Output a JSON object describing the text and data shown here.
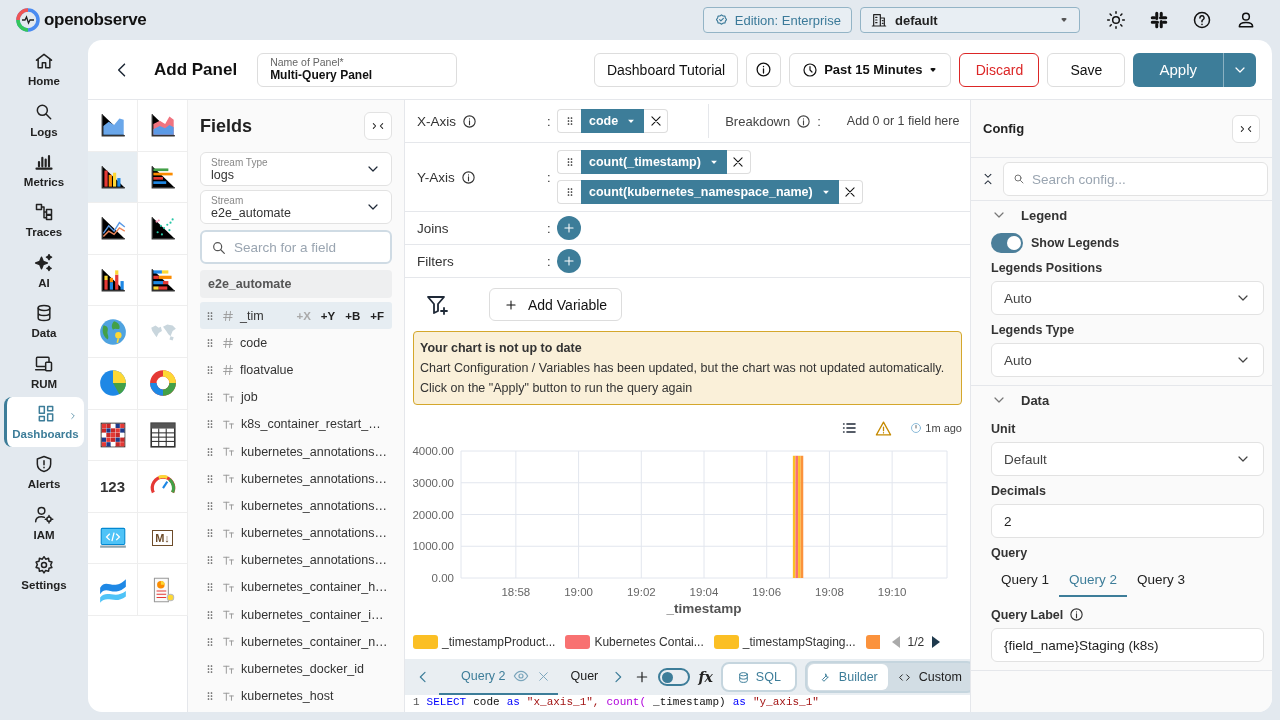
{
  "top_bar": {
    "brand": "openobserve",
    "edition": "Edition: Enterprise",
    "org": "default"
  },
  "nav": [
    {
      "label": "Home",
      "kind": "home",
      "selected": false
    },
    {
      "label": "Logs",
      "kind": "search",
      "selected": false
    },
    {
      "label": "Metrics",
      "kind": "metrics",
      "selected": false
    },
    {
      "label": "Traces",
      "kind": "traces",
      "selected": false
    },
    {
      "label": "AI",
      "kind": "ai",
      "selected": false
    },
    {
      "label": "Data",
      "kind": "data",
      "selected": false
    },
    {
      "label": "RUM",
      "kind": "rum",
      "selected": false
    },
    {
      "label": "Dashboards",
      "kind": "dashboards",
      "selected": true
    },
    {
      "label": "Alerts",
      "kind": "alerts",
      "selected": false
    },
    {
      "label": "IAM",
      "kind": "iam",
      "selected": false
    },
    {
      "label": "Settings",
      "kind": "settings",
      "selected": false
    }
  ],
  "header": {
    "title": "Add Panel",
    "name_label": "Name of Panel*",
    "name_value": "Multi-Query Panel",
    "tutorial": "Dashboard Tutorial",
    "time_range": "Past 15 Minutes",
    "discard": "Discard",
    "save": "Save",
    "apply": "Apply"
  },
  "chart_types": [
    {
      "kind": "area",
      "selected": false
    },
    {
      "kind": "area-stacked",
      "selected": false
    },
    {
      "kind": "bar",
      "selected": true
    },
    {
      "kind": "h-bar",
      "selected": false
    },
    {
      "kind": "line",
      "selected": false
    },
    {
      "kind": "scatter",
      "selected": false
    },
    {
      "kind": "stacked",
      "selected": false
    },
    {
      "kind": "h-stacked",
      "selected": false
    },
    {
      "kind": "geomap",
      "selected": false
    },
    {
      "kind": "maps",
      "selected": false
    },
    {
      "kind": "pie",
      "selected": false
    },
    {
      "kind": "donut",
      "selected": false
    },
    {
      "kind": "heatmap",
      "selected": false
    },
    {
      "kind": "table",
      "selected": false
    },
    {
      "kind": "metric",
      "label": "123",
      "selected": false
    },
    {
      "kind": "gauge",
      "selected": false
    },
    {
      "kind": "html",
      "selected": false
    },
    {
      "kind": "markdown",
      "label": "M↓",
      "selected": false
    },
    {
      "kind": "sankey",
      "selected": false
    },
    {
      "kind": "custom",
      "selected": false
    }
  ],
  "fields_panel": {
    "title": "Fields",
    "stream_type": {
      "label": "Stream Type",
      "value": "logs"
    },
    "stream": {
      "label": "Stream",
      "value": "e2e_automate"
    },
    "search": {
      "placeholder": "Search for a field"
    },
    "stream_name": "e2e_automate",
    "fields": [
      {
        "name": "_tim",
        "kind": "number",
        "hovered": true,
        "actions": [
          {
            "label": "+X",
            "disabled": true
          },
          {
            "label": "+Y",
            "disabled": false
          },
          {
            "label": "+B",
            "disabled": false
          },
          {
            "label": "+F",
            "disabled": false
          }
        ]
      },
      {
        "name": "code",
        "kind": "number",
        "hovered": false
      },
      {
        "name": "floatvalue",
        "kind": "number",
        "hovered": false
      },
      {
        "name": "job",
        "kind": "text",
        "hovered": false
      },
      {
        "name": "k8s_container_restart_…",
        "kind": "text",
        "hovered": false
      },
      {
        "name": "kubernetes_annotations…",
        "kind": "text",
        "hovered": false
      },
      {
        "name": "kubernetes_annotations…",
        "kind": "text",
        "hovered": false
      },
      {
        "name": "kubernetes_annotations…",
        "kind": "text",
        "hovered": false
      },
      {
        "name": "kubernetes_annotations…",
        "kind": "text",
        "hovered": false
      },
      {
        "name": "kubernetes_annotations…",
        "kind": "text",
        "hovered": false
      },
      {
        "name": "kubernetes_container_h…",
        "kind": "text",
        "hovered": false
      },
      {
        "name": "kubernetes_container_i…",
        "kind": "text",
        "hovered": false
      },
      {
        "name": "kubernetes_container_n…",
        "kind": "text",
        "hovered": false
      },
      {
        "name": "kubernetes_docker_id",
        "kind": "text",
        "hovered": false
      },
      {
        "name": "kubernetes_host",
        "kind": "text",
        "hovered": false
      }
    ]
  },
  "builder": [
    {
      "kind": "axis",
      "label": "X-Axis",
      "info": true,
      "separator": ":",
      "chips": [
        "code"
      ],
      "aside": {
        "label": "Breakdown",
        "info": true,
        "separator": ":",
        "placeholder": "Add 0 or 1 field here"
      }
    },
    {
      "kind": "axis",
      "label": "Y-Axis",
      "info": true,
      "separator": ":",
      "chips": [
        "count(_timestamp)",
        "count(kubernetes_namespace_name)"
      ]
    },
    {
      "kind": "add",
      "label": "Joins",
      "separator": ":"
    },
    {
      "kind": "add",
      "label": "Filters",
      "separator": ":"
    }
  ],
  "add_variable": "Add Variable",
  "warning": {
    "title": "Your chart is not up to date",
    "message": "Chart Configuration / Variables has been updated, but the chart was not updated automatically. Click on the \"Apply\" button to run the query again"
  },
  "chart_toolbar": {
    "updated": "1m ago"
  },
  "chart": {
    "chart_data": {
      "type": "bar",
      "grid": true,
      "xlabel": "_timestamp",
      "categories": [
        null,
        null,
        null,
        "18:58",
        null,
        null,
        null,
        "19:00",
        null,
        null,
        null,
        "19:02",
        null,
        null,
        null,
        "19:04",
        null,
        null,
        null,
        "19:06",
        null,
        null,
        null,
        "19:08",
        null,
        null,
        null,
        "19:10",
        null,
        null,
        null
      ],
      "ylim": [
        0,
        4000
      ],
      "yticks": [
        {
          "value": 0,
          "label": "0.00"
        },
        {
          "value": 1000,
          "label": "1000.00"
        },
        {
          "value": 2000,
          "label": "2000.00"
        },
        {
          "value": 3000,
          "label": "3000.00"
        },
        {
          "value": 4000,
          "label": "4000.00"
        }
      ],
      "series": [
        {
          "name": "_timestampProduct...",
          "color": "#fbbf24",
          "values": [
            null,
            null,
            null,
            null,
            null,
            null,
            null,
            null,
            null,
            null,
            null,
            null,
            null,
            null,
            null,
            null,
            null,
            null,
            null,
            null,
            null,
            3850,
            null,
            null,
            null,
            null,
            null,
            null,
            null,
            null,
            null
          ]
        },
        {
          "name": "Kubernetes Contai...",
          "color": "#f87171",
          "values": [
            null,
            null,
            null,
            null,
            null,
            null,
            null,
            null,
            null,
            null,
            null,
            null,
            null,
            null,
            null,
            null,
            null,
            null,
            null,
            null,
            null,
            3850,
            null,
            null,
            null,
            null,
            null,
            null,
            null,
            null,
            null
          ]
        },
        {
          "name": "_timestampStaging...",
          "color": "#fbbf24",
          "values": [
            null,
            null,
            null,
            null,
            null,
            null,
            null,
            null,
            null,
            null,
            null,
            null,
            null,
            null,
            null,
            null,
            null,
            null,
            null,
            null,
            null,
            3850,
            null,
            null,
            null,
            null,
            null,
            null,
            null,
            null,
            null
          ]
        },
        {
          "color": "#fb923c",
          "values": [
            null,
            null,
            null,
            null,
            null,
            null,
            null,
            null,
            null,
            null,
            null,
            null,
            null,
            null,
            null,
            null,
            null,
            null,
            null,
            null,
            null,
            3850,
            null,
            null,
            null,
            null,
            null,
            null,
            null,
            null,
            null
          ]
        }
      ]
    },
    "legend_page": "1/2",
    "legend_prev_disabled": true
  },
  "query_bar": {
    "tabs": [
      {
        "label": "Query 2",
        "selected": true
      },
      {
        "label": "Quer",
        "selected": false
      }
    ],
    "toggle_on": false,
    "function_label": "fx",
    "sql": "SQL",
    "modes": [
      {
        "label": "Builder",
        "kind": "builder",
        "selected": true
      },
      {
        "label": "Custom",
        "kind": "custom",
        "selected": false
      }
    ]
  },
  "editor": {
    "line_number": "1",
    "tokens": [
      {
        "text": "SELECT",
        "kind": "keyword"
      },
      {
        "text": "code",
        "kind": "plain"
      },
      {
        "text": "as",
        "kind": "keyword"
      },
      {
        "text": "\"x_axis_1\",",
        "kind": "string"
      },
      {
        "text": "count(",
        "kind": "function"
      },
      {
        "text": "_timestamp)",
        "kind": "plain"
      },
      {
        "text": "as",
        "kind": "keyword"
      },
      {
        "text": "\"y_axis_1\"",
        "kind": "string"
      }
    ]
  },
  "config": {
    "title": "Config",
    "search_placeholder": "Search config...",
    "sections": [
      {
        "title": "Legend",
        "expanded": true,
        "items": [
          {
            "kind": "toggle",
            "label": "Show Legends",
            "on": true
          },
          {
            "kind": "select",
            "label": "Legends Positions",
            "value": "Auto"
          },
          {
            "kind": "select",
            "label": "Legends Type",
            "value": "Auto"
          }
        ]
      },
      {
        "title": "Data",
        "expanded": true,
        "items": [
          {
            "kind": "select",
            "label": "Unit",
            "value": "Default"
          },
          {
            "kind": "input",
            "label": "Decimals",
            "value": "2"
          },
          {
            "kind": "tabs",
            "label": "Query",
            "tabs": [
              {
                "label": "Query 1",
                "selected": false
              },
              {
                "label": "Query 2",
                "selected": true
              },
              {
                "label": "Query 3",
                "selected": false
              }
            ]
          },
          {
            "kind": "input",
            "label": "Query Label",
            "info": true,
            "value": "{field_name}Staging (k8s)"
          }
        ]
      }
    ]
  }
}
